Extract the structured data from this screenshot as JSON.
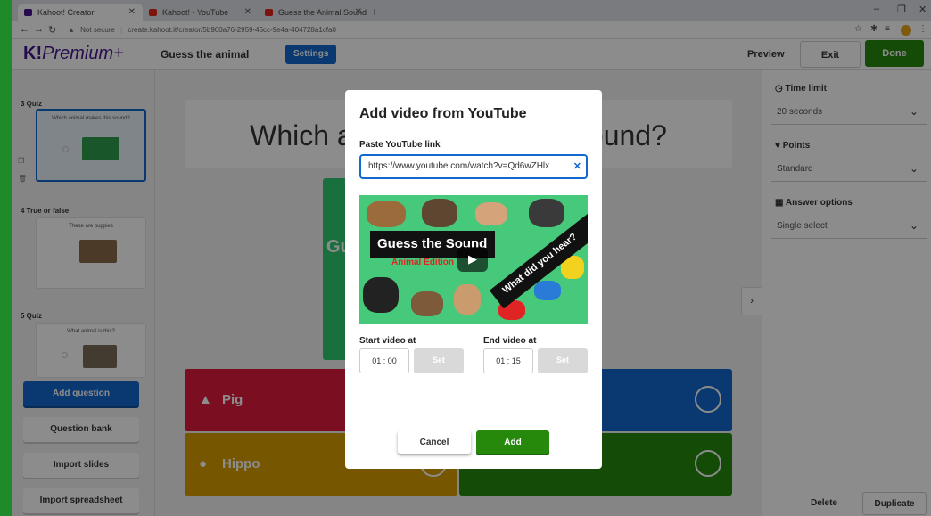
{
  "browser": {
    "tabs": [
      {
        "label": "Kahoot! Creator",
        "active": true
      },
      {
        "label": "Kahoot! - YouTube",
        "active": false
      },
      {
        "label": "Guess the Animal Sound Game",
        "active": false
      }
    ],
    "url": "create.kahoot.it/creator/5b960a76-2959-45cc-9e4a-404728a1cfa0",
    "security_label": "Not secure"
  },
  "header": {
    "logo_prefix": "K!",
    "logo_text": "Premium+",
    "kahoot_title": "Guess the animal",
    "settings_label": "Settings",
    "preview_label": "Preview",
    "exit_label": "Exit",
    "done_label": "Done"
  },
  "sidebar": {
    "slides": [
      {
        "label": "3  Quiz",
        "question": "Which animal makes this sound?"
      },
      {
        "label": "4  True or false",
        "question": "These are puppies"
      },
      {
        "label": "5  Quiz",
        "question": "What animal is this?"
      }
    ],
    "add_question_label": "Add question",
    "question_bank_label": "Question bank",
    "import_slides_label": "Import slides",
    "import_spreadsheet_label": "Import spreadsheet"
  },
  "canvas": {
    "question_text": "Which animal makes this sound?",
    "answers": [
      {
        "text": "Pig",
        "color": "#e21b3c",
        "shape": "triangle"
      },
      {
        "text": "",
        "color": "#1368ce",
        "shape": "diamond"
      },
      {
        "text": "Hippo",
        "color": "#d89e00",
        "shape": "circle"
      },
      {
        "text": "",
        "color": "#26890c",
        "shape": "square"
      }
    ]
  },
  "right_panel": {
    "time_limit_label": "Time limit",
    "time_limit_value": "20 seconds",
    "points_label": "Points",
    "points_value": "Standard",
    "answer_options_label": "Answer options",
    "answer_options_value": "Single select",
    "delete_label": "Delete",
    "duplicate_label": "Duplicate"
  },
  "modal": {
    "title": "Add video from YouTube",
    "link_label": "Paste YouTube link",
    "link_value": "https://www.youtube.com/watch?v=Qd6wZHlx",
    "video_title_line1": "Guess the Sound",
    "video_title_line2": "Animal Edition",
    "video_overlay_text": "What did you hear?",
    "start_label": "Start video at",
    "start_value": "01 : 00",
    "end_label": "End video at",
    "end_value": "01 : 15",
    "set_label": "Set",
    "cancel_label": "Cancel",
    "add_label": "Add"
  }
}
